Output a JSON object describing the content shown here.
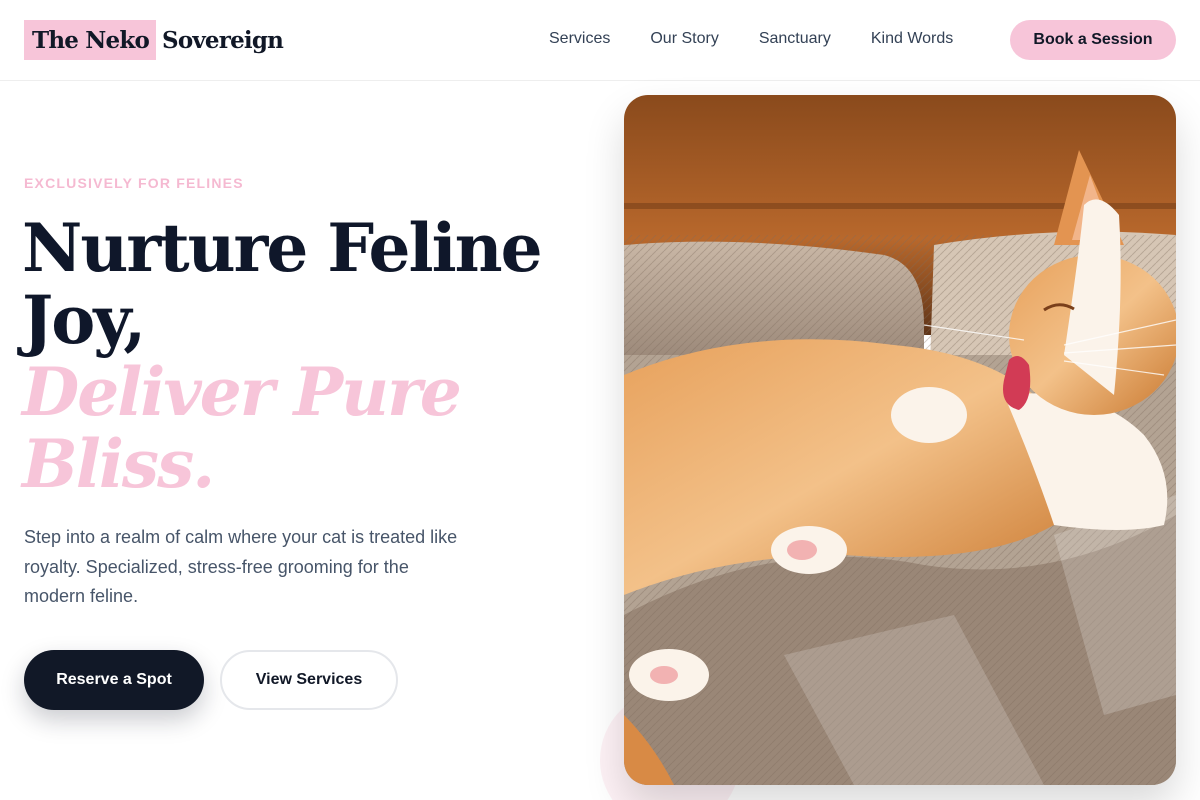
{
  "brand": {
    "name_highlight": "The Neko",
    "name_rest": "Sovereign",
    "accent_color": "#f7c5d9",
    "dark_color": "#111827"
  },
  "nav": {
    "links": [
      "Services",
      "Our Story",
      "Sanctuary",
      "Kind Words"
    ],
    "cta_label": "Book a Session"
  },
  "hero": {
    "eyebrow": "EXCLUSIVELY FOR FELINES",
    "headline_line1": "Nurture Feline",
    "headline_line2": "Joy,",
    "headline_accent_line1": "Deliver Pure",
    "headline_accent_line2": "Bliss.",
    "subtext": "Step into a realm of calm where your cat is treated like royalty. Specialized, stress-free grooming for the modern feline.",
    "primary_button": "Reserve a Spot",
    "secondary_button": "View Services",
    "image_icon": "cat-photo"
  }
}
